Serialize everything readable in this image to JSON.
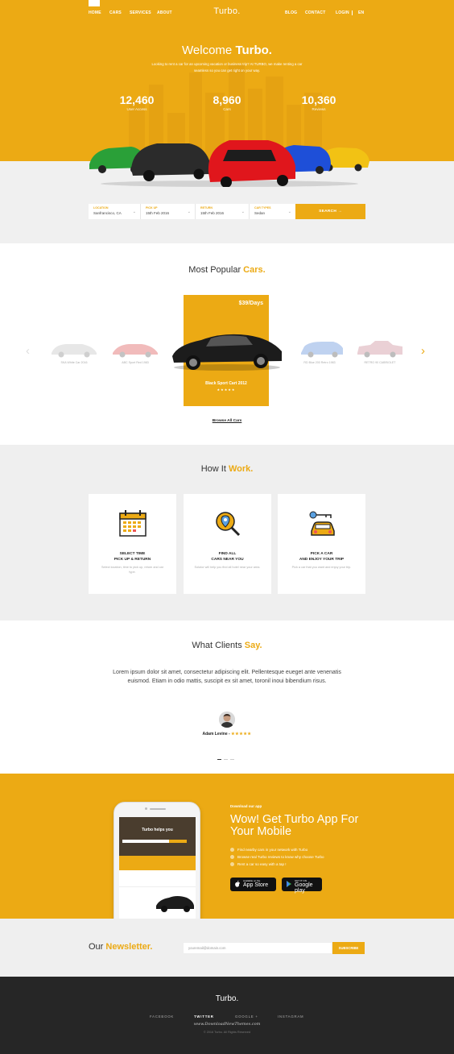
{
  "nav": {
    "left_links": [
      "HOME",
      "CARS",
      "SERVICES",
      "ABOUT"
    ],
    "brand": "Turbo.",
    "right_links": [
      "BLOG",
      "CONTACT"
    ],
    "login": "LOGIN",
    "lang": "EN"
  },
  "hero": {
    "title_prefix": "Welcome ",
    "title_strong": "Turbo.",
    "subtitle": "Looking to rent a car for an upcoming vacation or business trip? At TURBO, we make renting a car seamless so you can get right on your way.",
    "stats": [
      {
        "value": "12,460",
        "label": "User Access"
      },
      {
        "value": "8,960",
        "label": "Cars"
      },
      {
        "value": "10,360",
        "label": "Reviews"
      }
    ]
  },
  "search": {
    "fields": [
      {
        "key": "LOCATION",
        "value": "Sanfrancisco, CA"
      },
      {
        "key": "PICK UP",
        "value": "15th Feb 2016"
      },
      {
        "key": "RETURN",
        "value": "15th Feb 2016"
      },
      {
        "key": "CAR TYPES",
        "value": "Sedan"
      }
    ],
    "button": "SEARCH →"
  },
  "popular": {
    "title_prefix": "Most Popular ",
    "title_strong": "Cars.",
    "featured": {
      "price": "$39/Days",
      "name": "Black Sport Cart 2012",
      "stars": "★★★★★"
    },
    "side_cars": [
      "SKA White Car 2016",
      "ABC Sport Red 1983",
      "RD Blue 200 Retro 1983",
      "RETRO 90 CABRIOLET"
    ],
    "browse": "Browse All Cars"
  },
  "how": {
    "title_prefix": "How It ",
    "title_strong": "Work.",
    "steps": [
      {
        "line1": "SELECT TIME",
        "line2": "PICK UP & RETURN",
        "desc": "Select location, time to pick up, return and car type."
      },
      {
        "line1": "FIND ALL",
        "line2": "CARS NEAR YOU",
        "desc": "Solutor will help you find all hotel near your area."
      },
      {
        "line1": "PICK A CAR",
        "line2": "AND ENJOY YOUR TRIP",
        "desc": "Pick a car that you want and enjoy your trip."
      }
    ]
  },
  "clients": {
    "title_prefix": "What Clients ",
    "title_strong": "Say.",
    "quote": "Lorem ipsum dolor sit amet, consectetur adipiscing elit. Pellentesque eueget ante venenatis euismod. Etiam in odio mattis, suscipit ex sit amet, toronil inoui bibendium risus.",
    "author": "Adam Levine - ",
    "stars": "★★★★★"
  },
  "app": {
    "small": "Download our app",
    "title": "Wow! Get Turbo App For Your Mobile",
    "features": [
      "Find nearby cars in your network with Turbo",
      "Browse real Turbo reviews to know why choose Turbo",
      "Rent a car so easy with a tap !"
    ],
    "appstore_top": "Available on the",
    "appstore": "App Store",
    "google_top": "GET IT ON",
    "google": "Google play",
    "screen_title": "Turbo helps you"
  },
  "newsletter": {
    "title_prefix": "Our ",
    "title_strong": "Newsletter.",
    "placeholder": "youremail@domain.com",
    "button": "SUBSCRIBE"
  },
  "footer": {
    "brand": "Turbo.",
    "links": [
      "FACEBOOK",
      "TWITTER",
      "GOOGLE +",
      "INSTAGRAM"
    ],
    "watermark": "www.DownloadNewThemes.com",
    "copyright": "© 2016 Turbo. All Rights Reserved"
  },
  "colors": {
    "accent": "#ecaa14",
    "footer_bg": "#262626",
    "section_grey": "#efefef"
  }
}
